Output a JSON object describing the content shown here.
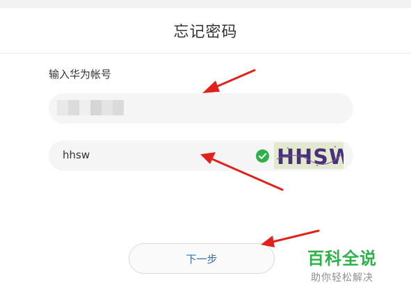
{
  "header": {
    "title": "忘记密码"
  },
  "form": {
    "account_label": "输入华为帐号",
    "captcha_value": "hhsw",
    "captcha_image_text": "HHSW",
    "next_label": "下一步"
  },
  "watermark": {
    "main": "百科全说",
    "sub": "助你轻松解决"
  },
  "colors": {
    "accent_green": "#2db24a",
    "arrow_red": "#e0221b",
    "link_blue": "#2e6fad",
    "captcha_purple": "#4a2f7a"
  },
  "icons": {
    "check": "check-circle-icon"
  }
}
